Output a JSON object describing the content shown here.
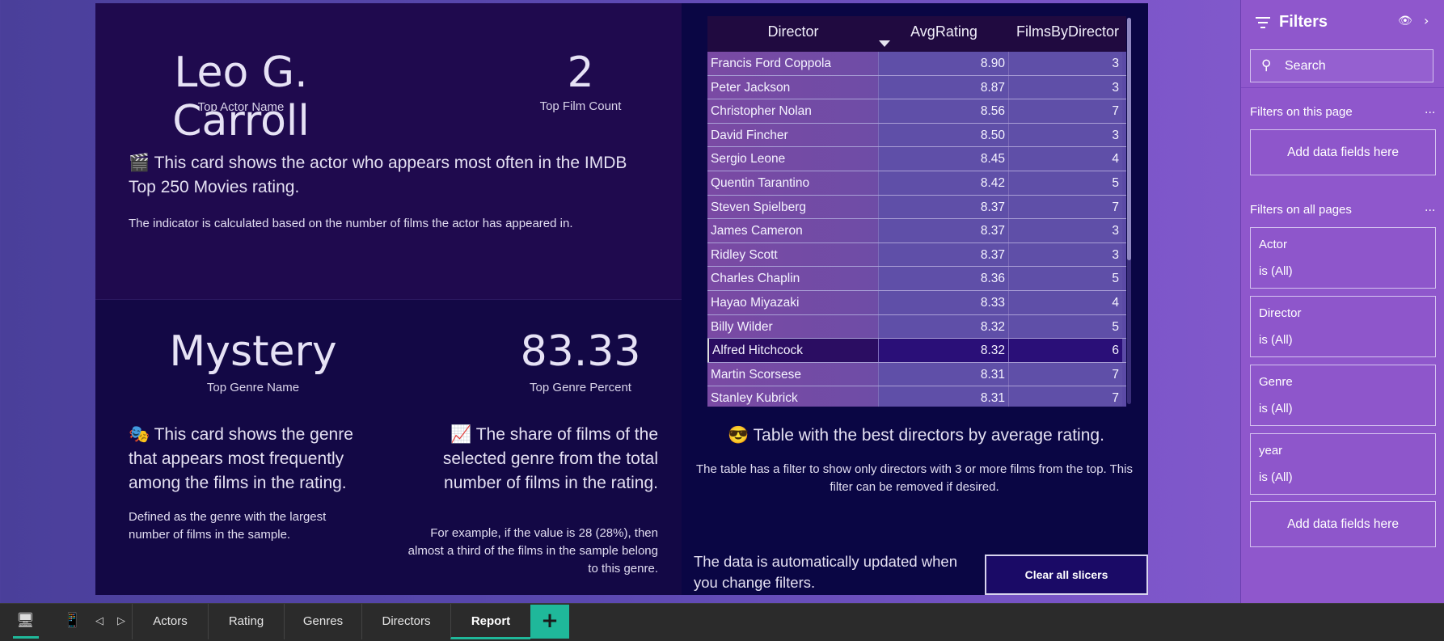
{
  "cards": {
    "actor": {
      "value": "Leo G. Carroll",
      "label": "Top Actor Name"
    },
    "film_count": {
      "value": "2",
      "label": "Top Film Count"
    },
    "actor_desc": "🎬 This card shows the actor who appears most often in the IMDB Top 250 Movies rating.",
    "actor_note": "The indicator is calculated based on the number of films the actor has appeared in.",
    "genre": {
      "value": "Mystery",
      "label": "Top Genre Name"
    },
    "genre_pct": {
      "value": "83.33",
      "label": "Top Genre Percent"
    },
    "genre_desc": "🎭 This card shows the genre that appears most frequently among the films in the rating.",
    "genre_note": "Defined as the genre with the largest number of films in the sample.",
    "pct_desc": "📈 The share of films of the selected genre from the total number of films in the rating.",
    "pct_note": "For example, if the value is 28 (28%), then almost a third of the films in the sample belong to this genre."
  },
  "table": {
    "headers": [
      "Director",
      "AvgRating",
      "FilmsByDirector"
    ],
    "rows": [
      [
        "Francis Ford Coppola",
        "8.90",
        "3"
      ],
      [
        "Peter Jackson",
        "8.87",
        "3"
      ],
      [
        "Christopher Nolan",
        "8.56",
        "7"
      ],
      [
        "David Fincher",
        "8.50",
        "3"
      ],
      [
        "Sergio Leone",
        "8.45",
        "4"
      ],
      [
        "Quentin Tarantino",
        "8.42",
        "5"
      ],
      [
        "Steven Spielberg",
        "8.37",
        "7"
      ],
      [
        "James Cameron",
        "8.37",
        "3"
      ],
      [
        "Ridley Scott",
        "8.37",
        "3"
      ],
      [
        "Charles Chaplin",
        "8.36",
        "5"
      ],
      [
        "Hayao Miyazaki",
        "8.33",
        "4"
      ],
      [
        "Billy Wilder",
        "8.32",
        "5"
      ],
      [
        "Alfred Hitchcock",
        "8.32",
        "6"
      ],
      [
        "Martin Scorsese",
        "8.31",
        "7"
      ],
      [
        "Stanley Kubrick",
        "8.31",
        "7"
      ]
    ],
    "selected_row": 12,
    "caption": "😎 Table with the best directors by average rating.",
    "note": "The table has a filter to show only directors with 3 or more films from the top. This filter can be removed if desired."
  },
  "footer_note": "The data is automatically updated when you change filters.",
  "clear_button": "Clear all slicers",
  "filters": {
    "title": "Filters",
    "search_placeholder": "Search",
    "this_page": "Filters on this page",
    "all_pages": "Filters on all pages",
    "add_fields": "Add data fields here",
    "more": "...",
    "items": [
      {
        "name": "Actor",
        "value": "is (All)"
      },
      {
        "name": "Director",
        "value": "is (All)"
      },
      {
        "name": "Genre",
        "value": "is (All)"
      },
      {
        "name": "year",
        "value": "is (All)"
      }
    ]
  },
  "tabs": [
    "Actors",
    "Rating",
    "Genres",
    "Directors",
    "Report"
  ],
  "active_tab": "Report",
  "add_tab": "+",
  "colors": {
    "accent": "#1fb89a",
    "canvas": "#0b0440",
    "filters_pane": "#8f57cc"
  }
}
